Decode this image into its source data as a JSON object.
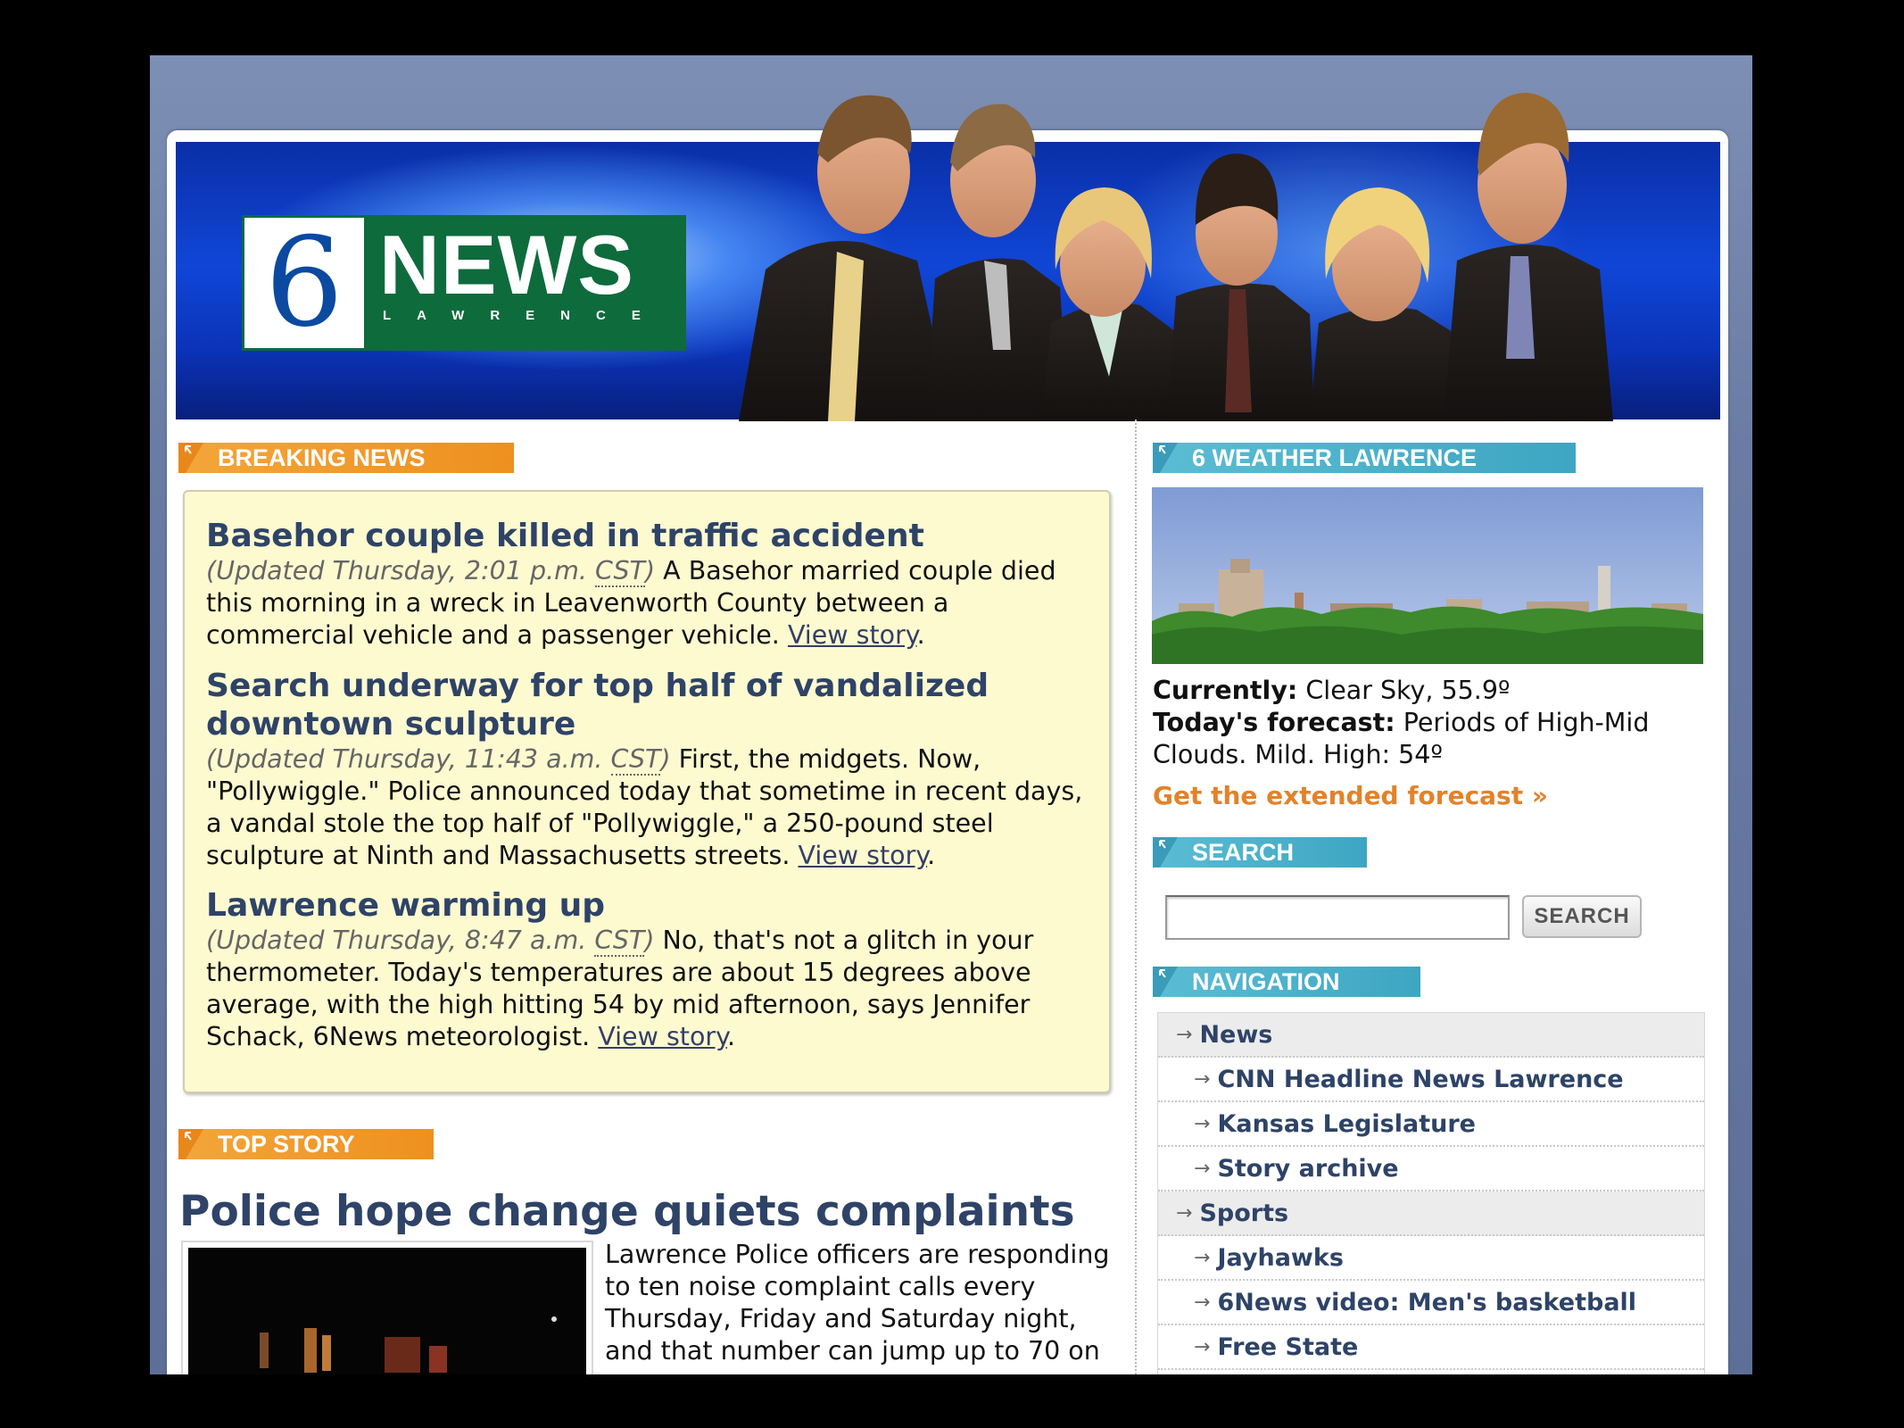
{
  "site": {
    "logo_number": "6",
    "logo_word": "NEWS",
    "logo_city": "LAWRENCE"
  },
  "breaking": {
    "heading": "BREAKING NEWS",
    "stories": [
      {
        "title": "Basehor couple killed in traffic accident",
        "updated": "(Updated Thursday, 2:01 p.m. ",
        "tz": "CST",
        "updated_close": ")",
        "body": " A Basehor married couple died this morning in a wreck in Leavenworth County between a commercial vehicle and a passenger vehicle. ",
        "link": "View story",
        "end": "."
      },
      {
        "title": "Search underway for top half of vandalized downtown sculpture",
        "updated": "(Updated Thursday, 11:43 a.m. ",
        "tz": "CST",
        "updated_close": ")",
        "body": " First, the midgets. Now, \"Pollywiggle.\" Police announced today that sometime in recent days, a vandal stole the top half of \"Pollywiggle,\" a 250-pound steel sculpture at Ninth and Massachusetts streets. ",
        "link": "View story",
        "end": "."
      },
      {
        "title": "Lawrence warming up",
        "updated": "(Updated Thursday, 8:47 a.m. ",
        "tz": "CST",
        "updated_close": ")",
        "body": " No, that's not a glitch in your thermometer. Today's temperatures are about 15 degrees above average, with the high hitting 54 by mid afternoon, says Jennifer Schack, 6News meteorologist. ",
        "link": "View story",
        "end": "."
      }
    ]
  },
  "top_story": {
    "heading": "TOP STORY",
    "headline": "Police hope change quiets complaints",
    "text": "Lawrence Police officers are responding to ten noise complaint calls every Thursday, Friday and Saturday night, and that number can jump up to 70 on"
  },
  "weather": {
    "heading": "6 WEATHER LAWRENCE",
    "currently_label": "Currently:",
    "currently_value": " Clear Sky, 55.9º",
    "forecast_label": "Today's forecast:",
    "forecast_value": " Periods of High-Mid Clouds. Mild. High: 54º",
    "extended_link": "Get the extended forecast »"
  },
  "search": {
    "heading": "SEARCH",
    "value": "",
    "button": "SEARCH"
  },
  "navigation": {
    "heading": "NAVIGATION",
    "items": [
      {
        "label": "News",
        "level": "top"
      },
      {
        "label": "CNN Headline News Lawrence",
        "level": "sub"
      },
      {
        "label": "Kansas Legislature",
        "level": "sub"
      },
      {
        "label": "Story archive",
        "level": "sub"
      },
      {
        "label": "Sports",
        "level": "top"
      },
      {
        "label": "Jayhawks",
        "level": "sub"
      },
      {
        "label": "6News video: Men's basketball",
        "level": "sub"
      },
      {
        "label": "Free State",
        "level": "sub"
      }
    ]
  },
  "colors": {
    "orange_tab": "#ee9020",
    "blue_tab": "#3ea6c2",
    "headline": "#2e4367",
    "link_orange": "#e3822a",
    "breaking_bg": "#fdfad0"
  }
}
